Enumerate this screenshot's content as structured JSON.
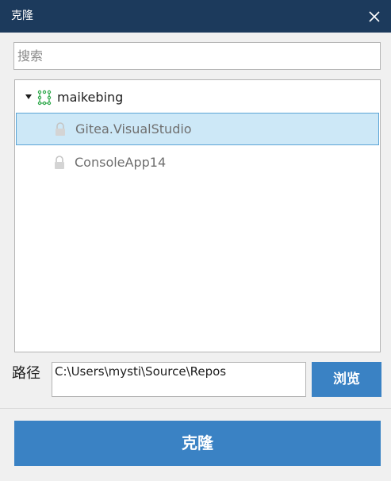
{
  "window": {
    "title": "克隆"
  },
  "search": {
    "placeholder": "搜索",
    "value": ""
  },
  "tree": {
    "organization": {
      "name": "maikebing",
      "expanded": true,
      "icon": "organization-icon"
    },
    "repositories": [
      {
        "name": "Gitea.VisualStudio",
        "selected": true,
        "icon": "lock-icon"
      },
      {
        "name": "ConsoleApp14",
        "selected": false,
        "icon": "lock-icon"
      }
    ]
  },
  "path": {
    "label": "路径",
    "value": "C:\\Users\\mysti\\Source\\Repos"
  },
  "buttons": {
    "browse_label": "浏览",
    "clone_label": "克隆"
  },
  "colors": {
    "titlebar": "#1c3a5c",
    "accent_button": "#3a82c4",
    "selection_background": "#cde8f7",
    "selection_border": "#5ba4d6",
    "org_icon": "#2ea84a"
  }
}
